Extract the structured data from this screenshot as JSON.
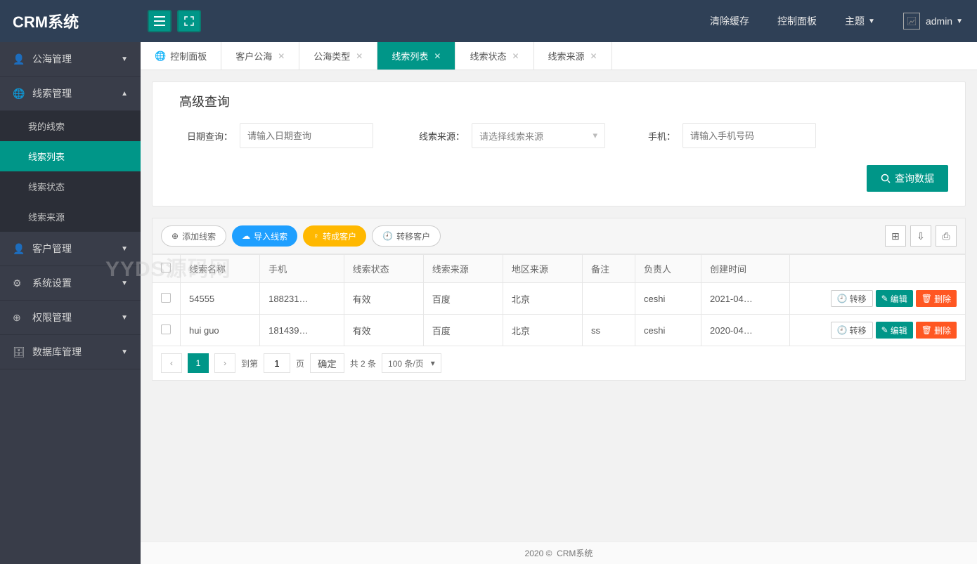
{
  "brand": "CRM系统",
  "topbar": {
    "clear_cache": "清除缓存",
    "dashboard": "控制面板",
    "theme": "主题",
    "user": "admin"
  },
  "sidebar": {
    "items": [
      {
        "label": "公海管理",
        "icon": "👤"
      },
      {
        "label": "线索管理",
        "icon": "🌐",
        "expanded": true
      },
      {
        "label": "客户管理",
        "icon": "👤"
      },
      {
        "label": "系统设置",
        "icon": "⚙"
      },
      {
        "label": "权限管理",
        "icon": "⊕"
      },
      {
        "label": "数据库管理",
        "icon": "🗄"
      }
    ],
    "submenu": [
      {
        "label": "我的线索"
      },
      {
        "label": "线索列表",
        "active": true
      },
      {
        "label": "线索状态"
      },
      {
        "label": "线索来源"
      }
    ]
  },
  "tabs": [
    {
      "label": "控制面板",
      "home": true
    },
    {
      "label": "客户公海"
    },
    {
      "label": "公海类型"
    },
    {
      "label": "线索列表",
      "active": true
    },
    {
      "label": "线索状态"
    },
    {
      "label": "线索来源"
    }
  ],
  "query": {
    "legend": "高级查询",
    "date_label": "日期查询：",
    "date_placeholder": "请输入日期查询",
    "source_label": "线索来源：",
    "source_placeholder": "请选择线索来源",
    "phone_label": "手机：",
    "phone_placeholder": "请输入手机号码",
    "search_btn": "查询数据"
  },
  "toolbar": {
    "add": "添加线索",
    "import": "导入线索",
    "convert": "转成客户",
    "transfer": "转移客户"
  },
  "table": {
    "headers": [
      "线索名称",
      "手机",
      "线索状态",
      "线索来源",
      "地区来源",
      "备注",
      "负责人",
      "创建时间",
      ""
    ],
    "rows": [
      {
        "name": "54555",
        "phone": "188231…",
        "status": "有效",
        "source": "百度",
        "region": "北京",
        "remark": "",
        "owner": "ceshi",
        "created": "2021-04…"
      },
      {
        "name": "hui guo",
        "phone": "181439…",
        "status": "有效",
        "source": "百度",
        "region": "北京",
        "remark": "ss",
        "owner": "ceshi",
        "created": "2020-04…"
      }
    ],
    "actions": {
      "transfer": "转移",
      "edit": "编辑",
      "delete": "删除"
    }
  },
  "pager": {
    "goto_label": "到第",
    "page_input": "1",
    "page_label": "页",
    "confirm": "确定",
    "total": "共 2 条",
    "perpage": "100 条/页"
  },
  "footer": {
    "year": "2020 ©",
    "name": "CRM系统"
  },
  "watermark": "YYDS源码网"
}
